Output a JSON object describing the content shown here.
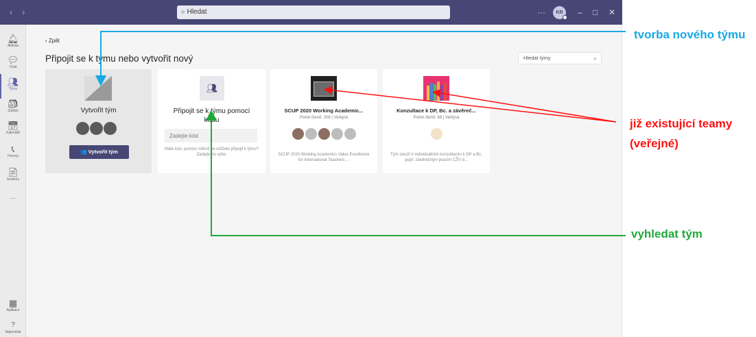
{
  "titlebar": {
    "back_arrow": "‹",
    "forward_arrow": "›",
    "search_placeholder": "Hledat",
    "more": "···",
    "avatar_initials": "KR",
    "minimize": "–",
    "maximize": "□",
    "close": "✕",
    "color": "#464775"
  },
  "rail": {
    "items": [
      {
        "icon": "bell-icon",
        "glyph": "🔔︎",
        "label": "Aktivita"
      },
      {
        "icon": "chat-icon",
        "glyph": "💬︎",
        "label": "Chat"
      },
      {
        "icon": "teams-icon",
        "glyph": "👥︎",
        "label": "Týmy"
      },
      {
        "icon": "assignments-icon",
        "glyph": "🎒︎",
        "label": "Zadání"
      },
      {
        "icon": "calendar-icon",
        "glyph": "📅︎",
        "label": "Kalendář"
      },
      {
        "icon": "calls-icon",
        "glyph": "📞︎",
        "label": "Hovory"
      },
      {
        "icon": "files-icon",
        "glyph": "📄︎",
        "label": "Soubory"
      },
      {
        "icon": "more-icon",
        "glyph": "···",
        "label": ""
      },
      {
        "icon": "apps-icon",
        "glyph": "▦",
        "label": "Aplikace"
      },
      {
        "icon": "help-icon",
        "glyph": "?",
        "label": "Nápověda"
      }
    ],
    "active_color": "#6264a7"
  },
  "main": {
    "back_label": "‹  Zpět",
    "page_title": "Připojit se k týmu nebo vytvořit nový",
    "team_search_placeholder": "Hledat týmy"
  },
  "create_card": {
    "title": "Vytvořit tým",
    "button_label": "Vytvořit tým",
    "button_icon": "👥"
  },
  "join_card": {
    "title": "Připojit se k týmu pomocí kódu",
    "code_placeholder": "Zadejte kód",
    "help": "Máte kód, pomocí něhož se můžete připojit k týmu? Zadejte ho výše."
  },
  "teams": [
    {
      "name": "SCUP 2020 Working Academic...",
      "meta": "Počet členů: 206 | Veřejná",
      "description": "SCUP 2020 Working Academics Value Excellence for International Teachers ..."
    },
    {
      "name": "Konzultace k DP, Bc. a závěreč...",
      "meta": "Počet členů: 68 | Veřejná",
      "description": "Tým slouží k individuálním konzultacím k DP a Bc. popř. závěrečným pracím CŽV d..."
    }
  ],
  "annotations": {
    "create_new_team": "tvorba nového týmu",
    "existing_teams": "již existující teamy (veřejné)",
    "search_team": "vyhledat tým",
    "colors": {
      "blue": "#17a9e3",
      "red": "#ff1010",
      "green": "#21a83a"
    }
  }
}
